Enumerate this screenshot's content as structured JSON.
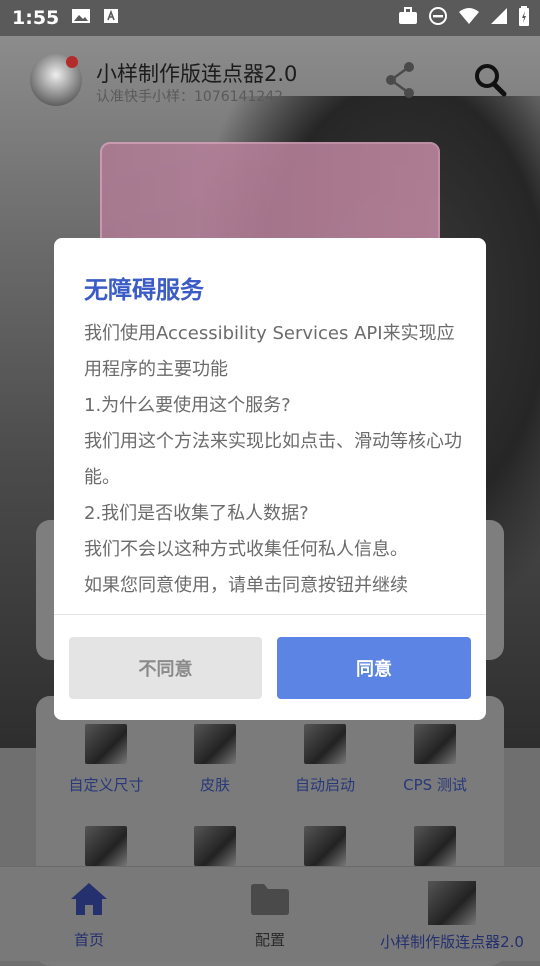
{
  "status_bar": {
    "time": "1:55"
  },
  "app": {
    "title": "小样制作版连点器2.0",
    "subtitle": "认准快手小样：1076141242"
  },
  "grid": {
    "items": [
      {
        "label": "自定义尺寸"
      },
      {
        "label": "皮肤"
      },
      {
        "label": "自动启动"
      },
      {
        "label": "CPS 测试"
      }
    ]
  },
  "bottom_nav": {
    "items": [
      {
        "label": "首页",
        "icon": "home-icon"
      },
      {
        "label": "配置",
        "icon": "folder-icon"
      },
      {
        "label": "小样制作版连点器2.0",
        "icon": "profile-thumbnail"
      }
    ]
  },
  "dialog": {
    "title": "无障碍服务",
    "paragraphs": [
      "我们使用Accessibility Services API来实现应用程序的主要功能",
      "1.为什么要使用这个服务?",
      "我们用这个方法来实现比如点击、滑动等核心功能。",
      "2.我们是否收集了私人数据?",
      "我们不会以这种方式收集任何私人信息。",
      "如果您同意使用，请单击同意按钮并继续"
    ],
    "disagree_label": "不同意",
    "agree_label": "同意"
  },
  "colors": {
    "accent": "#5b84e4",
    "title": "#3b5cc6",
    "nav_active": "#25306e"
  }
}
